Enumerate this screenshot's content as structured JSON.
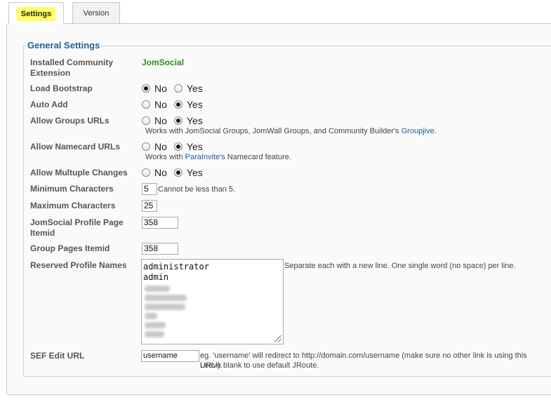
{
  "tabs": [
    {
      "label": "Settings",
      "active": true
    },
    {
      "label": "Version",
      "active": false
    }
  ],
  "section": {
    "legend": "General Settings"
  },
  "fields": {
    "installed_extension": {
      "label": "Installed Community Extension",
      "value": "JomSocial"
    },
    "load_bootstrap": {
      "label": "Load Bootstrap",
      "options": [
        "No",
        "Yes"
      ],
      "selected": "No"
    },
    "auto_add": {
      "label": "Auto Add",
      "options": [
        "No",
        "Yes"
      ],
      "selected": "Yes"
    },
    "allow_groups_urls": {
      "label": "Allow Groups URLs",
      "options": [
        "No",
        "Yes"
      ],
      "selected": "Yes",
      "note_prefix": "Works with JomSocial Groups, JomWall Groups, and Community Builder's ",
      "note_link": "Groupjive",
      "note_suffix": "."
    },
    "allow_namecard_urls": {
      "label": "Allow Namecard URLs",
      "options": [
        "No",
        "Yes"
      ],
      "selected": "Yes",
      "note_prefix": "Works with ",
      "note_link": "ParaInvite's",
      "note_suffix": " Namecard feature."
    },
    "allow_multiple_changes": {
      "label": "Allow Multuple Changes",
      "options": [
        "No",
        "Yes"
      ],
      "selected": "Yes"
    },
    "minimum_characters": {
      "label": "Minimum Characters",
      "value": "5",
      "note": "Cannot be less than 5."
    },
    "maximum_characters": {
      "label": "Maximum Characters",
      "value": "25"
    },
    "jomsocial_profile_itemid": {
      "label": "JomSocial Profile Page Itemid",
      "value": "358"
    },
    "group_pages_itemid": {
      "label": "Group Pages Itemid",
      "value": "358"
    },
    "reserved_profile_names": {
      "label": "Reserved Profile Names",
      "lines": [
        "administrator",
        "admin"
      ],
      "note": "Separate each with a new line. One single word (no space) per line."
    },
    "sef_edit_url": {
      "label": "SEF Edit URL",
      "value": "username",
      "note_line1": "eg. 'username' will redirect to http://domain.com/username (make sure no other link is using this URL!).",
      "note_line2": "Leave blank to use default JRoute."
    }
  }
}
